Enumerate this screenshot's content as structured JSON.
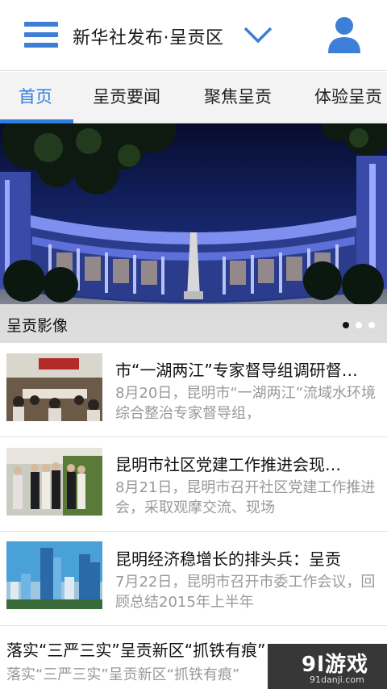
{
  "header": {
    "title": "新华社发布·呈贡区",
    "menu_icon": "hamburger-menu-icon",
    "dropdown_icon": "chevron-down-icon",
    "user_icon": "user-icon",
    "accent_color": "#3d7ed8"
  },
  "tabs": [
    {
      "label": "首页",
      "active": true
    },
    {
      "label": "呈贡要闻",
      "active": false
    },
    {
      "label": "聚焦呈贡",
      "active": false
    },
    {
      "label": "体验呈贡",
      "active": false
    }
  ],
  "banner": {
    "caption": "呈贡影像",
    "slide_count": 3,
    "active_slide": 1
  },
  "news": [
    {
      "title": "市“一湖两江”专家督导组调研督…",
      "summary": "8月20日，昆明市“一湖两江”流域水环境综合整治专家督导组，"
    },
    {
      "title": "昆明市社区党建工作推进会现…",
      "summary": "8月21日，昆明市召开社区党建工作推进会，采取观摩交流、现场"
    },
    {
      "title": "昆明经济稳增长的排头兵：呈贡",
      "summary": "7月22日，昆明市召开市委工作会议，回顾总结2015年上半年"
    },
    {
      "title": "落实“三严三实”呈贡新区“抓铁有痕”",
      "summary": "落实“三严三实”呈贡新区“抓铁有痕”"
    }
  ],
  "watermark": {
    "logo": "9l游戏",
    "url": "91danji.com"
  }
}
